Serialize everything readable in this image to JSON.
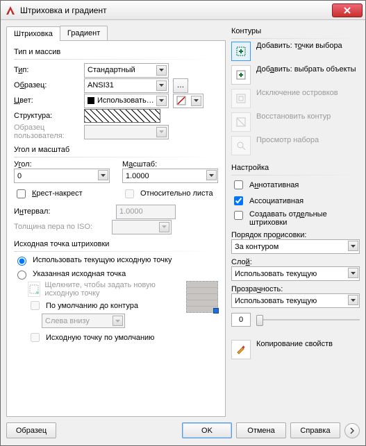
{
  "window": {
    "title": "Штриховка и градиент"
  },
  "tabs": {
    "hatch": "Штриховка",
    "gradient": "Градиент"
  },
  "type_group": {
    "title": "Тип и массив",
    "type_pre": "Т",
    "type_u": "и",
    "type_post": "п:",
    "type_value": "Стандартный",
    "sample_pre": "О",
    "sample_u": "б",
    "sample_post": "разец:",
    "sample_value": "ANSI31",
    "color_pre": "",
    "color_u": "Ц",
    "color_post": "вет:",
    "color_value": "Использовать теку",
    "struct_label": "Структура:",
    "user_sample_label": "Образец пользователя:"
  },
  "angle_group": {
    "title": "Угол и масштаб",
    "angle_pre": "У",
    "angle_u": "г",
    "angle_post": "ол:",
    "angle_value": "0",
    "scale_pre": "М",
    "scale_u": "а",
    "scale_post": "сштаб:",
    "scale_value": "1.0000",
    "cross_pre": "",
    "cross_u": "К",
    "cross_post": "рест-накрест",
    "relsheet_label": "Относительно листа",
    "interval_pre": "И",
    "interval_u": "н",
    "interval_post": "тервал:",
    "interval_value": "1.0000",
    "iso_label": "Толщина пера по ISO:"
  },
  "origin_group": {
    "title": "Исходная точка штриховки",
    "use_current": "Использовать текущую исходную точку",
    "specified": "Указанная исходная точка",
    "click_hint": "Щелкните, чтобы задать новую исходную точку",
    "default_to_contour": "По умолчанию до контура",
    "pos_value": "Слева внизу",
    "default_origin": "Исходную точку по умолчанию"
  },
  "contours": {
    "title": "Контуры",
    "add_points_pre": "Добавить: т",
    "add_points_u": "о",
    "add_points_post": "чки выбора",
    "add_objects_pre": "Доб",
    "add_objects_u": "а",
    "add_objects_post": "вить: выбрать объекты",
    "exclude": "Исключение островков",
    "restore": "Восстановить контур",
    "preview_set": "Просмотр набора"
  },
  "settings": {
    "title": "Настройка",
    "annotative_pre": "А",
    "annotative_u": "н",
    "annotative_post": "нотативная",
    "associative": "Ассоциативная",
    "separate_pre": "Создавать отд",
    "separate_u": "е",
    "separate_post": "льные штриховки",
    "draw_order_pre": "Порядок про",
    "draw_order_u": "р",
    "draw_order_post": "исовки:",
    "draw_order_value": "За контуром",
    "layer_pre": "Сло",
    "layer_u": "й",
    "layer_post": ":",
    "layer_value": "Использовать текущую",
    "transp_pre": "Прозра",
    "transp_u": "ч",
    "transp_post": "ность:",
    "transp_value": "Использовать текущую",
    "transp_num": "0",
    "copy_props": "Копирование свойств"
  },
  "footer": {
    "preview": "Образец",
    "ok": "OK",
    "cancel": "Отмена",
    "help": "Справка"
  }
}
